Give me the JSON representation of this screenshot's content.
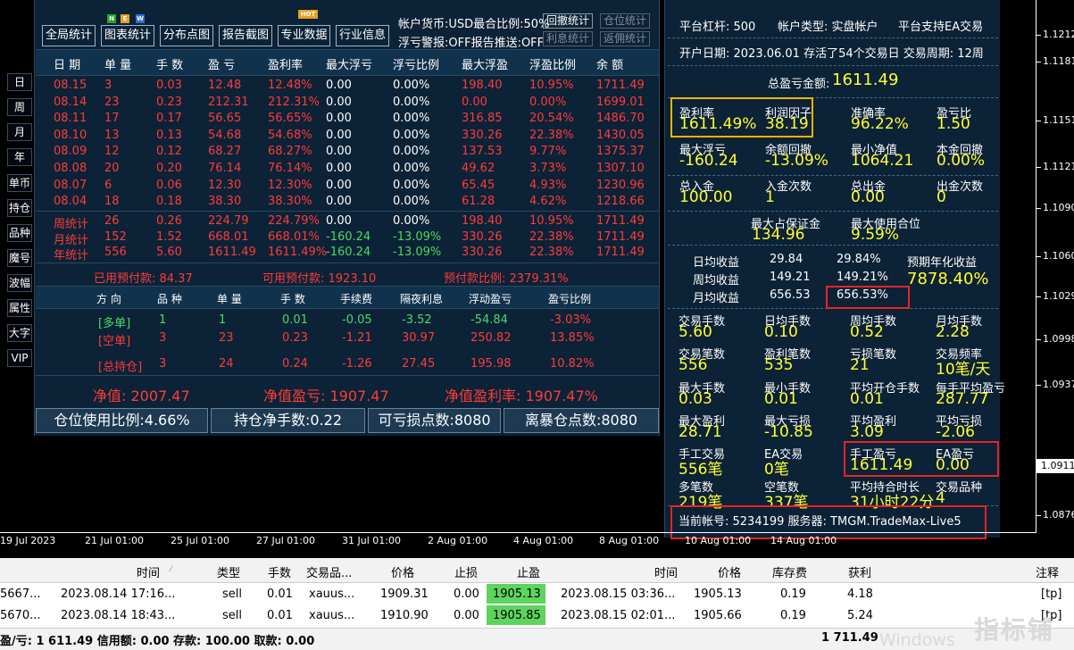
{
  "side_buttons": [
    "日",
    "周",
    "月",
    "年",
    "单币",
    "持仓",
    "品种",
    "魔号",
    "波幅",
    "属性",
    "大字",
    "VIP"
  ],
  "toolbar": {
    "buttons": [
      "全局统计",
      "图表统计",
      "分布点图",
      "报告截图",
      "专业数据",
      "行业信息"
    ],
    "new_badge": [
      "N",
      "E",
      "W"
    ],
    "hot_badge": "HOT",
    "account_currency": "帐户货币:USD最合比例:50%",
    "float_alert": "浮亏警报:OFF报告推送:OFF",
    "btn_withdraw_stats": "回撤统计",
    "btn_position_stats": "仓位统计",
    "btn_interest_stats": "利息统计",
    "btn_rebate_stats": "返佣统计"
  },
  "stats_table": {
    "headers": [
      "日 期",
      "单 量",
      "手 数",
      "盈 亏",
      "盈利率",
      "最大浮亏",
      "浮亏比例",
      "最大浮盈",
      "浮盈比例",
      "余 额"
    ],
    "rows": [
      [
        "08.15",
        "3",
        "0.03",
        "12.48",
        "12.48%",
        "0.00",
        "0.00%",
        "198.40",
        "10.95%",
        "1711.49"
      ],
      [
        "08.14",
        "23",
        "0.23",
        "212.31",
        "212.31%",
        "0.00",
        "0.00%",
        "0.00",
        "0.00%",
        "1699.01"
      ],
      [
        "08.11",
        "17",
        "0.17",
        "56.65",
        "56.65%",
        "0.00",
        "0.00%",
        "316.85",
        "20.54%",
        "1486.70"
      ],
      [
        "08.10",
        "13",
        "0.13",
        "54.68",
        "54.68%",
        "0.00",
        "0.00%",
        "330.26",
        "22.38%",
        "1430.05"
      ],
      [
        "08.09",
        "12",
        "0.12",
        "68.27",
        "68.27%",
        "0.00",
        "0.00%",
        "137.53",
        "9.77%",
        "1375.37"
      ],
      [
        "08.08",
        "20",
        "0.20",
        "76.14",
        "76.14%",
        "0.00",
        "0.00%",
        "49.62",
        "3.73%",
        "1307.10"
      ],
      [
        "08.07",
        "6",
        "0.06",
        "12.30",
        "12.30%",
        "0.00",
        "0.00%",
        "65.45",
        "4.93%",
        "1230.96"
      ],
      [
        "08.04",
        "18",
        "0.18",
        "38.30",
        "38.30%",
        "0.00",
        "0.00%",
        "61.28",
        "4.62%",
        "1218.66"
      ]
    ],
    "summary": [
      [
        "周统计",
        "26",
        "0.26",
        "224.79",
        "224.79%",
        "0.00",
        "0.00%",
        "198.40",
        "10.95%",
        "1711.49"
      ],
      [
        "月统计",
        "152",
        "1.52",
        "668.01",
        "668.01%",
        "-160.24",
        "-13.09%",
        "330.26",
        "22.38%",
        "1711.49"
      ],
      [
        "年统计",
        "556",
        "5.60",
        "1611.49",
        "1611.49%",
        "-160.24",
        "-13.09%",
        "330.26",
        "22.38%",
        "1711.49"
      ]
    ]
  },
  "prepay": {
    "used": "已用预付款: 84.37",
    "available": "可用预付款: 1923.10",
    "ratio": "预付款比例: 2379.31%"
  },
  "positions": {
    "headers": [
      "方 向",
      "品 种",
      "单 量",
      "手 数",
      "手续费",
      "隔夜利息",
      "浮动盈亏",
      "盈亏比例"
    ],
    "rows": [
      [
        "[多单]",
        "1",
        "1",
        "0.01",
        "-0.05",
        "-3.52",
        "-54.84",
        "-3.03%"
      ],
      [
        "[空单]",
        "3",
        "23",
        "0.23",
        "-1.21",
        "30.97",
        "250.82",
        "13.85%"
      ],
      [
        "[总持仓]",
        "3",
        "24",
        "0.24",
        "-1.26",
        "27.45",
        "195.98",
        "10.82%"
      ]
    ]
  },
  "equity": {
    "net": "净值: 2007.47",
    "net_profit": "净值盈亏: 1907.47",
    "net_rate": "净值盈利率: 1907.47%"
  },
  "bottom_bar": [
    "仓位使用比例:4.66%",
    "持仓净手数:0.22",
    "可亏损点数:8080",
    "离暴仓点数:8080"
  ],
  "right": {
    "leverage": "平台杠杆: 500",
    "account_type": "帐户类型: 实盘帐户",
    "ea_support": "平台支持EA交易",
    "open_date": "开户日期: 2023.06.01 存活了54个交易日 交易周期: 12周",
    "total_label": "总盈亏金额:",
    "total_value": "1611.49",
    "metrics": [
      {
        "label": "盈利率",
        "value": "1611.49%"
      },
      {
        "label": "利润因子",
        "value": "38.19"
      },
      {
        "label": "准确率",
        "value": "96.22%"
      },
      {
        "label": "盈亏比",
        "value": "1.50"
      },
      {
        "label": "最大浮亏",
        "value": "-160.24"
      },
      {
        "label": "余额回撤",
        "value": "-13.09%"
      },
      {
        "label": "最小净值",
        "value": "1064.21"
      },
      {
        "label": "本金回撤",
        "value": "0.00%"
      },
      {
        "label": "总入金",
        "value": "100.00"
      },
      {
        "label": "入金次数",
        "value": "1"
      },
      {
        "label": "总出金",
        "value": "0.00"
      },
      {
        "label": "出金次数",
        "value": "0"
      }
    ],
    "max_margin_label": "最大占保证金",
    "max_margin_value": "134.96",
    "max_pos_label": "最大使用合位",
    "max_pos_value": "9.59%",
    "daily": [
      "日均收益",
      "29.84",
      "29.84%"
    ],
    "weekly": [
      "周均收益",
      "149.21",
      "149.21%"
    ],
    "monthly": [
      "月均收益",
      "656.53",
      "656.53%"
    ],
    "annual_label": "预期年化收益",
    "annual_value": "7878.40%",
    "grid": [
      {
        "label": "交易手数",
        "value": "5.60"
      },
      {
        "label": "日均手数",
        "value": "0.10"
      },
      {
        "label": "周均手数",
        "value": "0.52"
      },
      {
        "label": "月均手数",
        "value": "2.28"
      },
      {
        "label": "交易笔数",
        "value": "556"
      },
      {
        "label": "盈利笔数",
        "value": "535"
      },
      {
        "label": "亏损笔数",
        "value": "21"
      },
      {
        "label": "交易频率",
        "value": "10笔/天"
      },
      {
        "label": "最大手数",
        "value": "0.03"
      },
      {
        "label": "最小手数",
        "value": "0.01"
      },
      {
        "label": "平均开仓手数",
        "value": "0.01"
      },
      {
        "label": "每手平均盈亏",
        "value": "287.77"
      },
      {
        "label": "最大盈利",
        "value": "28.71"
      },
      {
        "label": "最大亏损",
        "value": "-10.85"
      },
      {
        "label": "平均盈利",
        "value": "3.09"
      },
      {
        "label": "平均亏损",
        "value": "-2.06"
      },
      {
        "label": "手工交易",
        "value": "556笔"
      },
      {
        "label": "EA交易",
        "value": "0笔"
      },
      {
        "label": "手工盈亏",
        "value": "1611.49"
      },
      {
        "label": "EA盈亏",
        "value": "0.00"
      },
      {
        "label": "多笔数",
        "value": "219笔"
      },
      {
        "label": "空笔数",
        "value": "337笔"
      },
      {
        "label": "平均持合时长",
        "value": "31小时22分"
      },
      {
        "label": "交易品种",
        "value": "4"
      }
    ],
    "account": "当前帐号: 5234199 服务器: TMGM.TradeMax-Live5"
  },
  "price_axis": [
    "1.1212",
    "1.1181",
    "1.1151",
    "1.1121",
    "1.1090",
    "1.1060",
    "1.1029",
    "1.0998",
    "1.0968",
    "1.0937",
    "1.0911",
    "1.0876"
  ],
  "time_axis": [
    "19 Jul 2023",
    "21 Jul 01:00",
    "25 Jul 01:00",
    "27 Jul 01:00",
    "31 Jul 01:00",
    "2 Aug 01:00",
    "4 Aug 01:00",
    "8 Aug 01:00",
    "10 Aug 01:00",
    "14 Aug 01:00"
  ],
  "trade_table": {
    "headers": [
      "时间",
      "类型",
      "手数",
      "交易品...",
      "价格",
      "止损",
      "止盈",
      "时间",
      "价格",
      "库存费",
      "获利",
      "注释"
    ],
    "rows": [
      [
        "5667...",
        "2023.08.14 17:16...",
        "sell",
        "0.01",
        "xauus...",
        "1909.31",
        "0.00",
        "1905.13",
        "2023.08.15 03:36...",
        "1905.13",
        "0.19",
        "4.18",
        "[tp]"
      ],
      [
        "5670...",
        "2023.08.14 18:43...",
        "sell",
        "0.01",
        "xauus...",
        "1910.90",
        "0.00",
        "1905.85",
        "2023.08.15 02:01...",
        "1905.66",
        "0.19",
        "5.24",
        "[tp]"
      ]
    ],
    "footer": "盈/亏: 1 611.49 信用额: 0.00 存款: 100.00 取款: 0.00",
    "footer_total": "1 711.49",
    "watermark": "指标铺",
    "windows_text": "Windows"
  }
}
